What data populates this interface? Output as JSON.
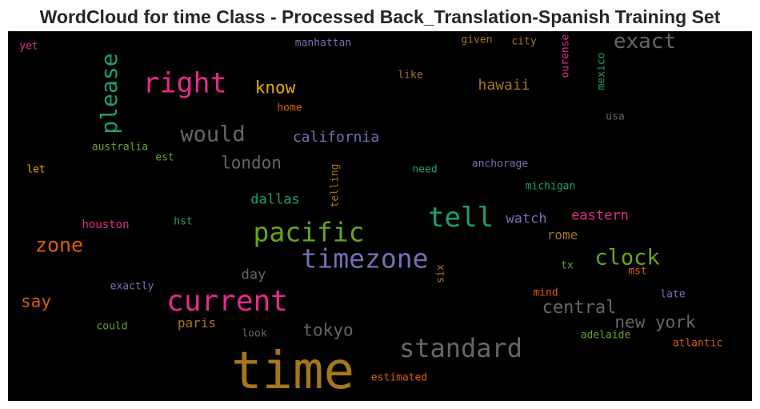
{
  "chart_data": {
    "type": "wordcloud",
    "title": "WordCloud for time Class - Processed Back_Translation-Spanish Training Set",
    "background": "#000000",
    "colormap": [
      "#1b9e77",
      "#d95f02",
      "#7570b3",
      "#e7298a",
      "#66a61e",
      "#e6ab02",
      "#a6761d",
      "#666666"
    ],
    "words": [
      {
        "text": "time",
        "color": "#a6761d"
      },
      {
        "text": "current",
        "color": "#e7298a"
      },
      {
        "text": "timezone",
        "color": "#7570b3"
      },
      {
        "text": "pacific",
        "color": "#66a61e"
      },
      {
        "text": "standard",
        "color": "#666666"
      },
      {
        "text": "tell",
        "color": "#1b9e77"
      },
      {
        "text": "right",
        "color": "#e7298a"
      },
      {
        "text": "please",
        "color": "#1b9e77"
      },
      {
        "text": "clock",
        "color": "#66a61e"
      },
      {
        "text": "exact",
        "color": "#666666"
      },
      {
        "text": "would",
        "color": "#666666"
      },
      {
        "text": "zone",
        "color": "#d95f02"
      },
      {
        "text": "central",
        "color": "#666666"
      },
      {
        "text": "new york",
        "color": "#666666"
      },
      {
        "text": "tokyo",
        "color": "#666666"
      },
      {
        "text": "london",
        "color": "#666666"
      },
      {
        "text": "know",
        "color": "#e6ab02"
      },
      {
        "text": "california",
        "color": "#7570b3"
      },
      {
        "text": "say",
        "color": "#d95f02"
      },
      {
        "text": "hawaii",
        "color": "#a6761d"
      },
      {
        "text": "watch",
        "color": "#7570b3"
      },
      {
        "text": "eastern",
        "color": "#e7298a"
      },
      {
        "text": "dallas",
        "color": "#1b9e77"
      },
      {
        "text": "paris",
        "color": "#a6761d"
      },
      {
        "text": "rome",
        "color": "#a6761d"
      },
      {
        "text": "day",
        "color": "#666666"
      },
      {
        "text": "houston",
        "color": "#e7298a"
      },
      {
        "text": "australia",
        "color": "#66a61e"
      },
      {
        "text": "anchorage",
        "color": "#7570b3"
      },
      {
        "text": "michigan",
        "color": "#1b9e77"
      },
      {
        "text": "manhattan",
        "color": "#7570b3"
      },
      {
        "text": "home",
        "color": "#d95f02"
      },
      {
        "text": "like",
        "color": "#a6761d"
      },
      {
        "text": "given",
        "color": "#a6761d"
      },
      {
        "text": "city",
        "color": "#a6761d"
      },
      {
        "text": "ourense",
        "color": "#e7298a"
      },
      {
        "text": "mexico",
        "color": "#1b9e77"
      },
      {
        "text": "usa",
        "color": "#666666"
      },
      {
        "text": "est",
        "color": "#66a61e"
      },
      {
        "text": "let",
        "color": "#e6ab02"
      },
      {
        "text": "need",
        "color": "#1b9e77"
      },
      {
        "text": "telling",
        "color": "#a6761d"
      },
      {
        "text": "hst",
        "color": "#1b9e77"
      },
      {
        "text": "tx",
        "color": "#66a61e"
      },
      {
        "text": "mst",
        "color": "#d95f02"
      },
      {
        "text": "six",
        "color": "#a6761d"
      },
      {
        "text": "exactly",
        "color": "#7570b3"
      },
      {
        "text": "mind",
        "color": "#d95f02"
      },
      {
        "text": "late",
        "color": "#7570b3"
      },
      {
        "text": "could",
        "color": "#66a61e"
      },
      {
        "text": "look",
        "color": "#666666"
      },
      {
        "text": "adelaide",
        "color": "#66a61e"
      },
      {
        "text": "atlantic",
        "color": "#d95f02"
      },
      {
        "text": "estimated",
        "color": "#d95f02"
      },
      {
        "text": "yet",
        "color": "#e7298a"
      }
    ]
  }
}
